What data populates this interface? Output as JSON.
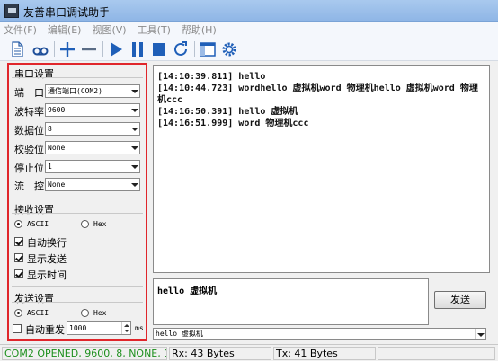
{
  "window": {
    "title": "友善串口调试助手"
  },
  "menu": [
    {
      "label": "文件(F)"
    },
    {
      "label": "编辑(E)"
    },
    {
      "label": "视图(V)"
    },
    {
      "label": "工具(T)"
    },
    {
      "label": "帮助(H)"
    }
  ],
  "toolbar": {
    "icons": [
      "new-file-icon",
      "loop-icon",
      "add-icon",
      "remove-icon",
      "play-icon",
      "pause-icon",
      "stop-icon",
      "refresh-icon",
      "window-icon",
      "gear-icon"
    ]
  },
  "serial_settings": {
    "title": "串口设置",
    "port": {
      "label": "端　口",
      "value": "通信端口(COM2)"
    },
    "baud": {
      "label": "波特率",
      "value": "9600"
    },
    "databits": {
      "label": "数据位",
      "value": "8"
    },
    "parity": {
      "label": "校验位",
      "value": "None"
    },
    "stopbits": {
      "label": "停止位",
      "value": "1"
    },
    "flow": {
      "label": "流　控",
      "value": "None"
    }
  },
  "receive_settings": {
    "title": "接收设置",
    "ascii_label": "ASCII",
    "hex_label": "Hex",
    "selected": "ASCII",
    "auto_newline": {
      "label": "自动换行",
      "checked": true
    },
    "show_send": {
      "label": "显示发送",
      "checked": true
    },
    "show_time": {
      "label": "显示时间",
      "checked": true
    }
  },
  "send_settings": {
    "title": "发送设置",
    "ascii_label": "ASCII",
    "hex_label": "Hex",
    "selected": "ASCII",
    "auto_resend": {
      "label": "自动重发",
      "checked": false
    },
    "interval": "1000",
    "unit": "ms"
  },
  "receive_log": [
    "[14:10:39.811] hello",
    "[14:10:44.723] wordhello 虚拟机word 物理机hello 虚拟机word 物理机ccc",
    "[14:16:50.391] hello 虚拟机",
    "[14:16:51.999] word 物理机ccc"
  ],
  "send_text": "hello 虚拟机",
  "send_button": "发送",
  "history_value": "hello 虚拟机",
  "status": {
    "connection": "COM2 OPENED, 9600, 8, NONE, 1, OFF",
    "rx": "Rx: 43 Bytes",
    "tx": "Tx: 41 Bytes"
  },
  "colors": {
    "highlight_border": "#e0262b",
    "status_ok": "#1c8f1c",
    "toolbar_blue": "#1f5fb8"
  }
}
